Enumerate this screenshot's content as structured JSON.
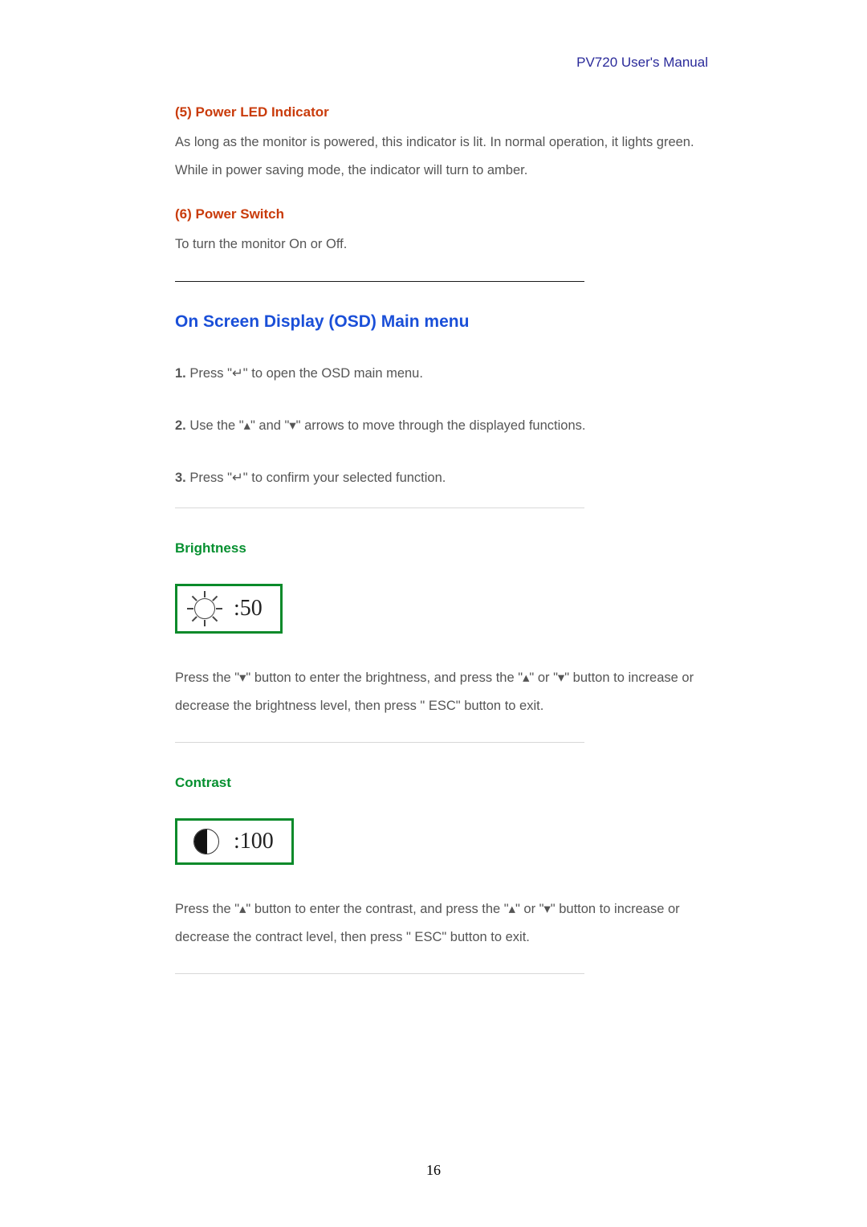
{
  "header": {
    "title": "PV720 User's Manual"
  },
  "section5": {
    "heading": "(5) Power LED Indicator",
    "text": "As long as the monitor is powered, this indicator is lit. In normal operation, it lights green. While in power saving mode, the indicator will turn to amber."
  },
  "section6": {
    "heading": "(6) Power Switch",
    "text": "To turn the monitor On or Off."
  },
  "osd": {
    "heading": "On Screen Display (OSD) Main menu",
    "steps": [
      {
        "num": "1.",
        "before": " Press \"",
        "sym": "↵",
        "after": "\" to open the OSD main menu."
      },
      {
        "num": "2.",
        "before": " Use the \"",
        "sym1": "▴",
        "mid": "\" and \"",
        "sym2": "▾",
        "after": "\" arrows to move through the displayed functions."
      },
      {
        "num": "3.",
        "before": " Press \"",
        "sym": "↵",
        "after": "\" to confirm your selected function."
      }
    ]
  },
  "brightness": {
    "heading": "Brightness",
    "value": ":50",
    "text": "Press the \"▾\" button to enter the brightness, and press the \"▴\" or \"▾\" button to increase or decrease the brightness level, then press \" ESC\" button to exit."
  },
  "contrast": {
    "heading": "Contrast",
    "value": ":100",
    "text": "Press the \"▴\" button to enter the contrast, and press the \"▴\" or \"▾\" button to increase or decrease the contract level, then press \" ESC\" button to exit."
  },
  "pageNumber": "16"
}
